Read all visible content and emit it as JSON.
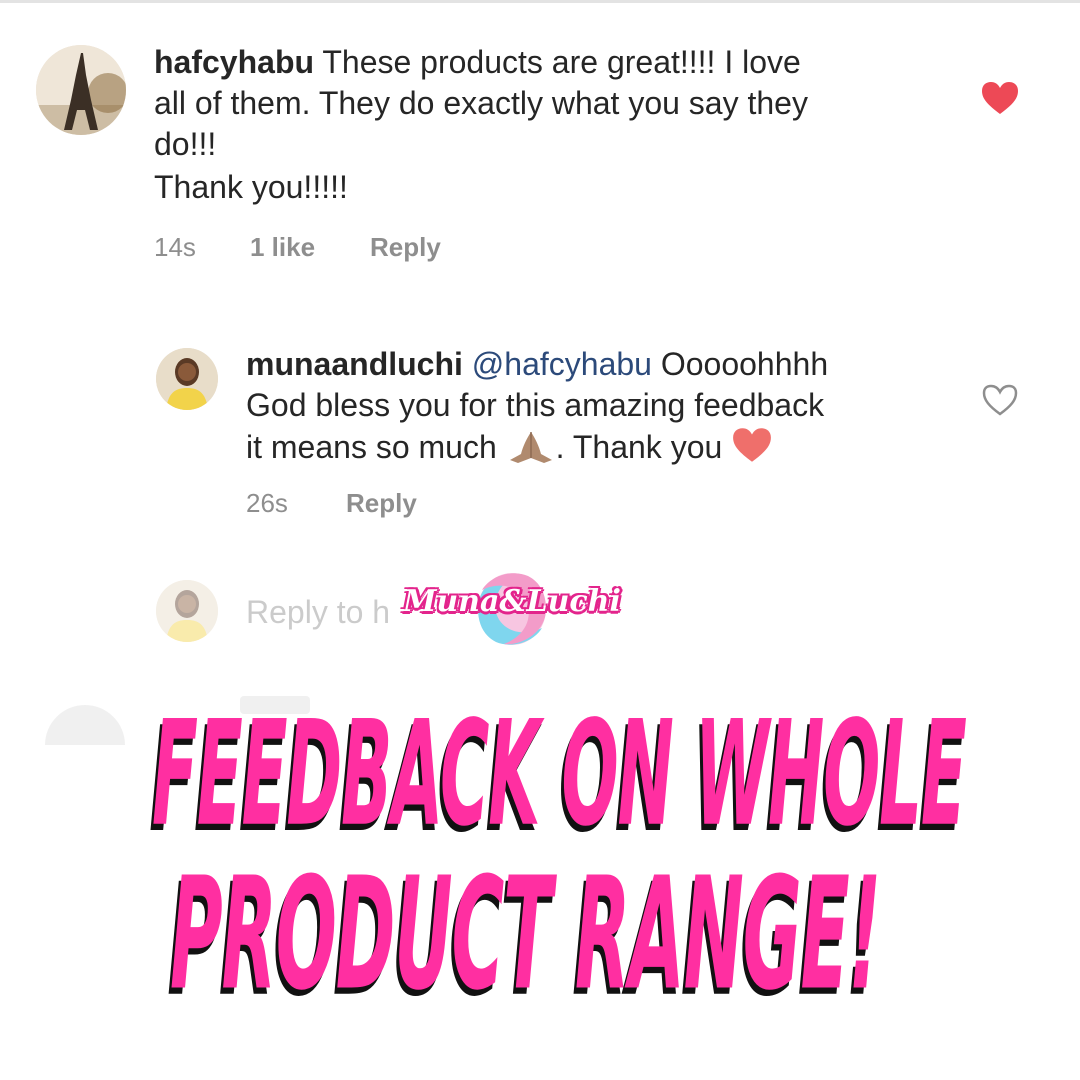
{
  "comments": [
    {
      "username": "hafcyhabu",
      "lines": [
        "These products are great!!!! I love",
        "all of them. They do exactly what you say they",
        "do!!!",
        "Thank you!!!!!"
      ],
      "time": "14s",
      "likes": "1 like",
      "reply_label": "Reply",
      "liked": true
    },
    {
      "username": "munaandluchi",
      "mention": "@hafcyhabu",
      "line1_after_mention": "Ooooohhhh",
      "line2": "God bless you for this amazing feedback",
      "line3_before_emoji": "it means so much",
      "line3_after_emoji": ". Thank you",
      "time": "26s",
      "reply_label": "Reply",
      "liked": false
    }
  ],
  "reply_input": {
    "placeholder": "Reply to h"
  },
  "logo": {
    "text": "Muna&Luchi"
  },
  "banner": {
    "line1": "FEEDBACK ON WHOLE",
    "line2": "PRODUCT RANGE!"
  },
  "colors": {
    "liked_heart": "#ed4956",
    "mention": "#2c4a7a",
    "banner_pink": "#ff2fa1",
    "banner_shadow": "#111111",
    "meta_gray": "#8e8e8e"
  },
  "icons": {
    "avatar_1": "eiffel-tower-avatar",
    "avatar_2": "profile-photo-avatar",
    "like_filled": "heart-filled-icon",
    "like_outline": "heart-outline-icon",
    "praying_hands": "praying-hands-emoji",
    "red_heart": "red-heart-emoji"
  }
}
